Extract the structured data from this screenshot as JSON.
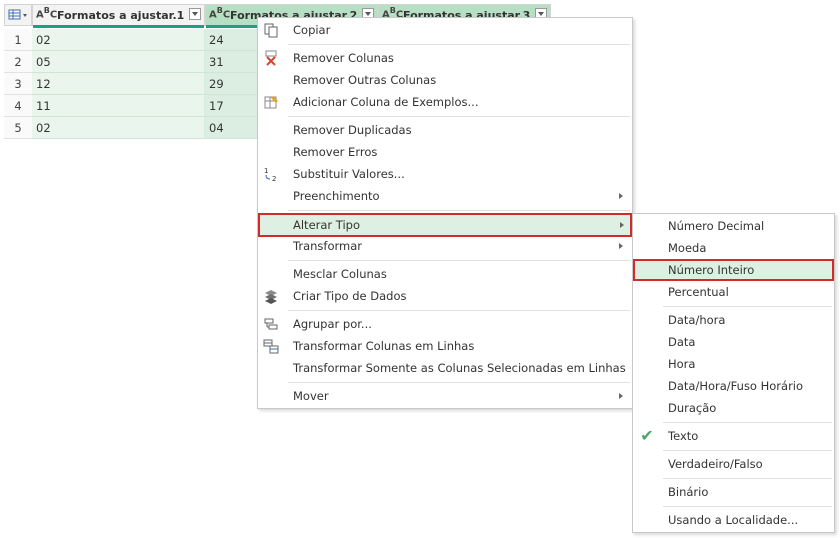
{
  "table": {
    "columns": [
      {
        "type_icon": "ABC",
        "title": "Formatos a ajustar.1"
      },
      {
        "type_icon": "ABC",
        "title": "Formatos a ajustar.2"
      },
      {
        "type_icon": "ABC",
        "title": "Formatos a ajustar.3"
      }
    ],
    "rows": [
      {
        "num": "1",
        "c1": "02",
        "c2": "24"
      },
      {
        "num": "2",
        "c1": "05",
        "c2": "31"
      },
      {
        "num": "3",
        "c1": "12",
        "c2": "29"
      },
      {
        "num": "4",
        "c1": "11",
        "c2": "17"
      },
      {
        "num": "5",
        "c1": "02",
        "c2": "04"
      }
    ]
  },
  "context_menu": {
    "copy": "Copiar",
    "remove_columns": "Remover Colunas",
    "remove_other_columns": "Remover Outras Colunas",
    "add_column_examples": "Adicionar Coluna de Exemplos...",
    "remove_duplicates": "Remover Duplicadas",
    "remove_errors": "Remover Erros",
    "replace_values": "Substituir Valores...",
    "fill": "Preenchimento",
    "change_type": "Alterar Tipo",
    "transform": "Transformar",
    "merge_columns": "Mesclar Colunas",
    "create_data_type": "Criar Tipo de Dados",
    "group_by": "Agrupar por...",
    "unpivot_columns": "Transformar Colunas em Linhas",
    "unpivot_selected": "Transformar Somente as Colunas Selecionadas em Linhas",
    "move": "Mover"
  },
  "type_submenu": {
    "decimal": "Número Decimal",
    "currency": "Moeda",
    "integer": "Número Inteiro",
    "percent": "Percentual",
    "datetime": "Data/hora",
    "date": "Data",
    "time": "Hora",
    "datetimezone": "Data/Hora/Fuso Horário",
    "duration": "Duração",
    "text": "Texto",
    "boolean": "Verdadeiro/Falso",
    "binary": "Binário",
    "locale": "Usando a Localidade..."
  },
  "colors": {
    "highlight_outline": "#d12b2b",
    "selected_column": "#b7dfc4",
    "accent_bar": "#1aa182",
    "check": "#4aa86a"
  }
}
